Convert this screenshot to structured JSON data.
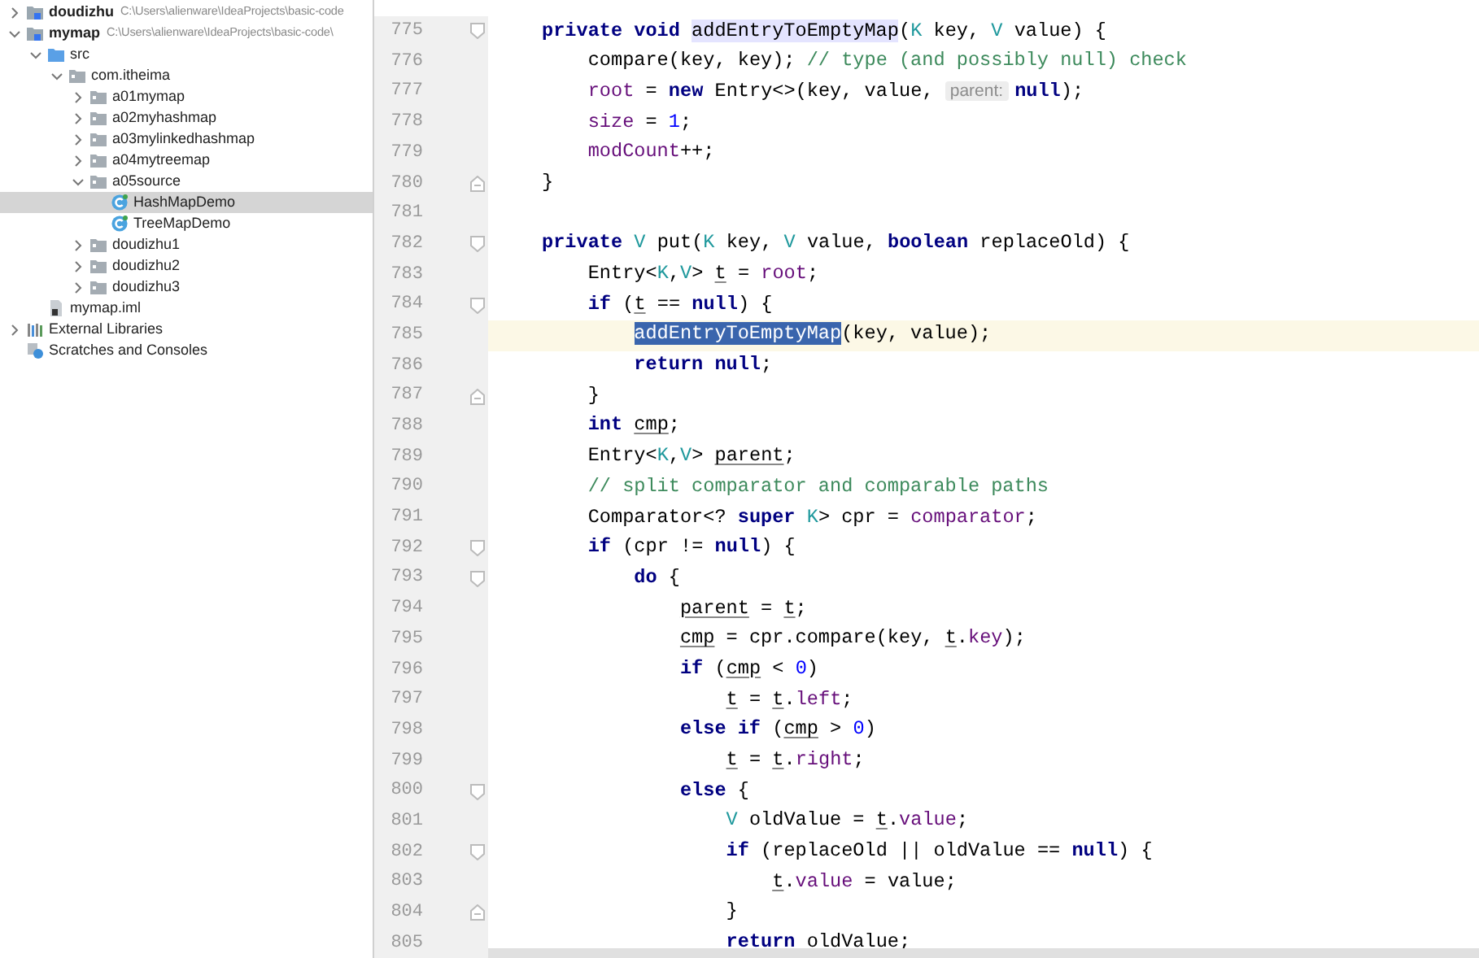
{
  "project_tree": [
    {
      "label": "doudizhu",
      "path": "C:\\Users\\alienware\\IdeaProjects\\basic-code",
      "kind": "module",
      "expanded": false,
      "selected": false
    },
    {
      "label": "mymap",
      "path": "C:\\Users\\alienware\\IdeaProjects\\basic-code\\",
      "kind": "module",
      "expanded": true,
      "selected": false,
      "children": [
        {
          "label": "src",
          "kind": "source_folder",
          "expanded": true,
          "selected": false,
          "children": [
            {
              "label": "com.itheima",
              "kind": "package",
              "expanded": true,
              "selected": false,
              "children": [
                {
                  "label": "a01mymap",
                  "kind": "package",
                  "expanded": false,
                  "selected": false
                },
                {
                  "label": "a02myhashmap",
                  "kind": "package",
                  "expanded": false,
                  "selected": false
                },
                {
                  "label": "a03mylinkedhashmap",
                  "kind": "package",
                  "expanded": false,
                  "selected": false
                },
                {
                  "label": "a04mytreemap",
                  "kind": "package",
                  "expanded": false,
                  "selected": false
                },
                {
                  "label": "a05source",
                  "kind": "package",
                  "expanded": true,
                  "selected": false,
                  "children": [
                    {
                      "label": "HashMapDemo",
                      "kind": "class",
                      "selected": true
                    },
                    {
                      "label": "TreeMapDemo",
                      "kind": "class",
                      "selected": false
                    }
                  ]
                },
                {
                  "label": "doudizhu1",
                  "kind": "package",
                  "expanded": false,
                  "selected": false
                },
                {
                  "label": "doudizhu2",
                  "kind": "package",
                  "expanded": false,
                  "selected": false
                },
                {
                  "label": "doudizhu3",
                  "kind": "package",
                  "expanded": false,
                  "selected": false
                }
              ]
            }
          ]
        },
        {
          "label": "mymap.iml",
          "kind": "file",
          "selected": false
        }
      ]
    },
    {
      "label": "External Libraries",
      "kind": "libraries",
      "expanded": false,
      "selected": false
    },
    {
      "label": "Scratches and Consoles",
      "kind": "scratches",
      "selected": false
    }
  ],
  "editor": {
    "lines": [
      {
        "number": "775",
        "fold": {
          "kind": "start"
        },
        "current": false,
        "tokens": [
          {
            "kind": "keyword",
            "text": "private void "
          },
          {
            "kind": "usage",
            "text": "addEntryToEmptyMap"
          },
          {
            "kind": "plain",
            "text": "("
          },
          {
            "kind": "typeparam",
            "text": "K"
          },
          {
            "kind": "plain",
            "text": " key, "
          },
          {
            "kind": "typeparam",
            "text": "V"
          },
          {
            "kind": "plain",
            "text": " value) {"
          }
        ]
      },
      {
        "number": "776",
        "current": false,
        "tokens": [
          {
            "kind": "plain",
            "text": "    compare(key, key); "
          },
          {
            "kind": "comment",
            "text": "// type (and possibly null) check"
          }
        ]
      },
      {
        "number": "777",
        "current": false,
        "tokens": [
          {
            "kind": "field",
            "text": "    root"
          },
          {
            "kind": "plain",
            "text": " = "
          },
          {
            "kind": "keyword",
            "text": "new"
          },
          {
            "kind": "plain",
            "text": " Entry<>(key, value, "
          },
          {
            "kind": "hint",
            "text": "parent:"
          },
          {
            "kind": "keyword",
            "text": "null"
          },
          {
            "kind": "plain",
            "text": ");"
          }
        ]
      },
      {
        "number": "778",
        "current": false,
        "tokens": [
          {
            "kind": "field",
            "text": "    size"
          },
          {
            "kind": "plain",
            "text": " = "
          },
          {
            "kind": "number",
            "text": "1"
          },
          {
            "kind": "plain",
            "text": ";"
          }
        ]
      },
      {
        "number": "779",
        "current": false,
        "tokens": [
          {
            "kind": "field",
            "text": "    modCount"
          },
          {
            "kind": "plain",
            "text": "++;"
          }
        ]
      },
      {
        "number": "780",
        "fold": {
          "kind": "end"
        },
        "current": false,
        "tokens": [
          {
            "kind": "plain",
            "text": "}"
          }
        ]
      },
      {
        "number": "781",
        "current": false
      },
      {
        "number": "782",
        "fold": {
          "kind": "start"
        },
        "current": false,
        "tokens": [
          {
            "kind": "keyword",
            "text": "private "
          },
          {
            "kind": "typeparam",
            "text": "V"
          },
          {
            "kind": "plain",
            "text": " put("
          },
          {
            "kind": "typeparam",
            "text": "K"
          },
          {
            "kind": "plain",
            "text": " key, "
          },
          {
            "kind": "typeparam",
            "text": "V"
          },
          {
            "kind": "plain",
            "text": " value, "
          },
          {
            "kind": "keyword",
            "text": "boolean"
          },
          {
            "kind": "plain",
            "text": " replaceOld) {"
          }
        ]
      },
      {
        "number": "783",
        "current": false,
        "tokens": [
          {
            "kind": "plain",
            "text": "    Entry<"
          },
          {
            "kind": "typeparam",
            "text": "K"
          },
          {
            "kind": "plain",
            "text": ","
          },
          {
            "kind": "typeparam",
            "text": "V"
          },
          {
            "kind": "plain",
            "text": "> "
          },
          {
            "kind": "local",
            "text": "t"
          },
          {
            "kind": "plain",
            "text": " = "
          },
          {
            "kind": "field",
            "text": "root"
          },
          {
            "kind": "plain",
            "text": ";"
          }
        ]
      },
      {
        "number": "784",
        "fold": {
          "kind": "start"
        },
        "current": false,
        "tokens": [
          {
            "kind": "keyword",
            "text": "    if"
          },
          {
            "kind": "plain",
            "text": " ("
          },
          {
            "kind": "local",
            "text": "t"
          },
          {
            "kind": "plain",
            "text": " == "
          },
          {
            "kind": "keyword",
            "text": "null"
          },
          {
            "kind": "plain",
            "text": ") {"
          }
        ]
      },
      {
        "number": "785",
        "current": true,
        "tokens": [
          {
            "kind": "selection",
            "text": "        addEntryToEmptyMap"
          },
          {
            "kind": "plain",
            "text": "(key, value);"
          }
        ]
      },
      {
        "number": "786",
        "current": false,
        "tokens": [
          {
            "kind": "keyword",
            "text": "        return null"
          },
          {
            "kind": "plain",
            "text": ";"
          }
        ]
      },
      {
        "number": "787",
        "fold": {
          "kind": "end"
        },
        "current": false,
        "tokens": [
          {
            "kind": "plain",
            "text": "    }"
          }
        ]
      },
      {
        "number": "788",
        "current": false,
        "tokens": [
          {
            "kind": "keyword",
            "text": "    int "
          },
          {
            "kind": "local",
            "text": "cmp"
          },
          {
            "kind": "plain",
            "text": ";"
          }
        ]
      },
      {
        "number": "789",
        "current": false,
        "tokens": [
          {
            "kind": "plain",
            "text": "    Entry<"
          },
          {
            "kind": "typeparam",
            "text": "K"
          },
          {
            "kind": "plain",
            "text": ","
          },
          {
            "kind": "typeparam",
            "text": "V"
          },
          {
            "kind": "plain",
            "text": "> "
          },
          {
            "kind": "local",
            "text": "parent"
          },
          {
            "kind": "plain",
            "text": ";"
          }
        ]
      },
      {
        "number": "790",
        "current": false,
        "tokens": [
          {
            "kind": "comment",
            "text": "    // split comparator and comparable paths"
          }
        ]
      },
      {
        "number": "791",
        "current": false,
        "tokens": [
          {
            "kind": "plain",
            "text": "    Comparator<? "
          },
          {
            "kind": "keyword",
            "text": "super "
          },
          {
            "kind": "typeparam",
            "text": "K"
          },
          {
            "kind": "plain",
            "text": "> cpr = "
          },
          {
            "kind": "field",
            "text": "comparator"
          },
          {
            "kind": "plain",
            "text": ";"
          }
        ]
      },
      {
        "number": "792",
        "fold": {
          "kind": "start"
        },
        "current": false,
        "tokens": [
          {
            "kind": "keyword",
            "text": "    if"
          },
          {
            "kind": "plain",
            "text": " (cpr != "
          },
          {
            "kind": "keyword",
            "text": "null"
          },
          {
            "kind": "plain",
            "text": ") {"
          }
        ]
      },
      {
        "number": "793",
        "fold": {
          "kind": "start"
        },
        "current": false,
        "tokens": [
          {
            "kind": "keyword",
            "text": "        do"
          },
          {
            "kind": "plain",
            "text": " {"
          }
        ]
      },
      {
        "number": "794",
        "current": false,
        "tokens": [
          {
            "kind": "local",
            "text": "            parent"
          },
          {
            "kind": "plain",
            "text": " = "
          },
          {
            "kind": "local",
            "text": "t"
          },
          {
            "kind": "plain",
            "text": ";"
          }
        ]
      },
      {
        "number": "795",
        "current": false,
        "tokens": [
          {
            "kind": "local",
            "text": "            cmp"
          },
          {
            "kind": "plain",
            "text": " = cpr.compare(key, "
          },
          {
            "kind": "local",
            "text": "t"
          },
          {
            "kind": "plain",
            "text": "."
          },
          {
            "kind": "field",
            "text": "key"
          },
          {
            "kind": "plain",
            "text": ");"
          }
        ]
      },
      {
        "number": "796",
        "current": false,
        "tokens": [
          {
            "kind": "keyword",
            "text": "            if"
          },
          {
            "kind": "plain",
            "text": " ("
          },
          {
            "kind": "local",
            "text": "cmp"
          },
          {
            "kind": "plain",
            "text": " < "
          },
          {
            "kind": "number",
            "text": "0"
          },
          {
            "kind": "plain",
            "text": ")"
          }
        ]
      },
      {
        "number": "797",
        "current": false,
        "tokens": [
          {
            "kind": "local",
            "text": "                t"
          },
          {
            "kind": "plain",
            "text": " = "
          },
          {
            "kind": "local",
            "text": "t"
          },
          {
            "kind": "plain",
            "text": "."
          },
          {
            "kind": "field",
            "text": "left"
          },
          {
            "kind": "plain",
            "text": ";"
          }
        ]
      },
      {
        "number": "798",
        "current": false,
        "tokens": [
          {
            "kind": "keyword",
            "text": "            else if"
          },
          {
            "kind": "plain",
            "text": " ("
          },
          {
            "kind": "local",
            "text": "cmp"
          },
          {
            "kind": "plain",
            "text": " > "
          },
          {
            "kind": "number",
            "text": "0"
          },
          {
            "kind": "plain",
            "text": ")"
          }
        ]
      },
      {
        "number": "799",
        "current": false,
        "tokens": [
          {
            "kind": "local",
            "text": "                t"
          },
          {
            "kind": "plain",
            "text": " = "
          },
          {
            "kind": "local",
            "text": "t"
          },
          {
            "kind": "plain",
            "text": "."
          },
          {
            "kind": "field",
            "text": "right"
          },
          {
            "kind": "plain",
            "text": ";"
          }
        ]
      },
      {
        "number": "800",
        "fold": {
          "kind": "start"
        },
        "current": false,
        "tokens": [
          {
            "kind": "keyword",
            "text": "            else"
          },
          {
            "kind": "plain",
            "text": " {"
          }
        ]
      },
      {
        "number": "801",
        "current": false,
        "tokens": [
          {
            "kind": "typeparam",
            "text": "                V"
          },
          {
            "kind": "plain",
            "text": " oldValue = "
          },
          {
            "kind": "local",
            "text": "t"
          },
          {
            "kind": "plain",
            "text": "."
          },
          {
            "kind": "field",
            "text": "value"
          },
          {
            "kind": "plain",
            "text": ";"
          }
        ]
      },
      {
        "number": "802",
        "fold": {
          "kind": "start"
        },
        "current": false,
        "tokens": [
          {
            "kind": "keyword",
            "text": "                if"
          },
          {
            "kind": "plain",
            "text": " (replaceOld || oldValue == "
          },
          {
            "kind": "keyword",
            "text": "null"
          },
          {
            "kind": "plain",
            "text": ") {"
          }
        ]
      },
      {
        "number": "803",
        "current": false,
        "tokens": [
          {
            "kind": "local",
            "text": "                    t"
          },
          {
            "kind": "plain",
            "text": "."
          },
          {
            "kind": "field",
            "text": "value"
          },
          {
            "kind": "plain",
            "text": " = value;"
          }
        ]
      },
      {
        "number": "804",
        "fold": {
          "kind": "end"
        },
        "current": false,
        "tokens": [
          {
            "kind": "plain",
            "text": "                }"
          }
        ]
      },
      {
        "number": "805",
        "current": false,
        "tokens": [
          {
            "kind": "keyword",
            "text": "                return"
          },
          {
            "kind": "plain",
            "text": " oldValue;"
          }
        ]
      }
    ]
  }
}
